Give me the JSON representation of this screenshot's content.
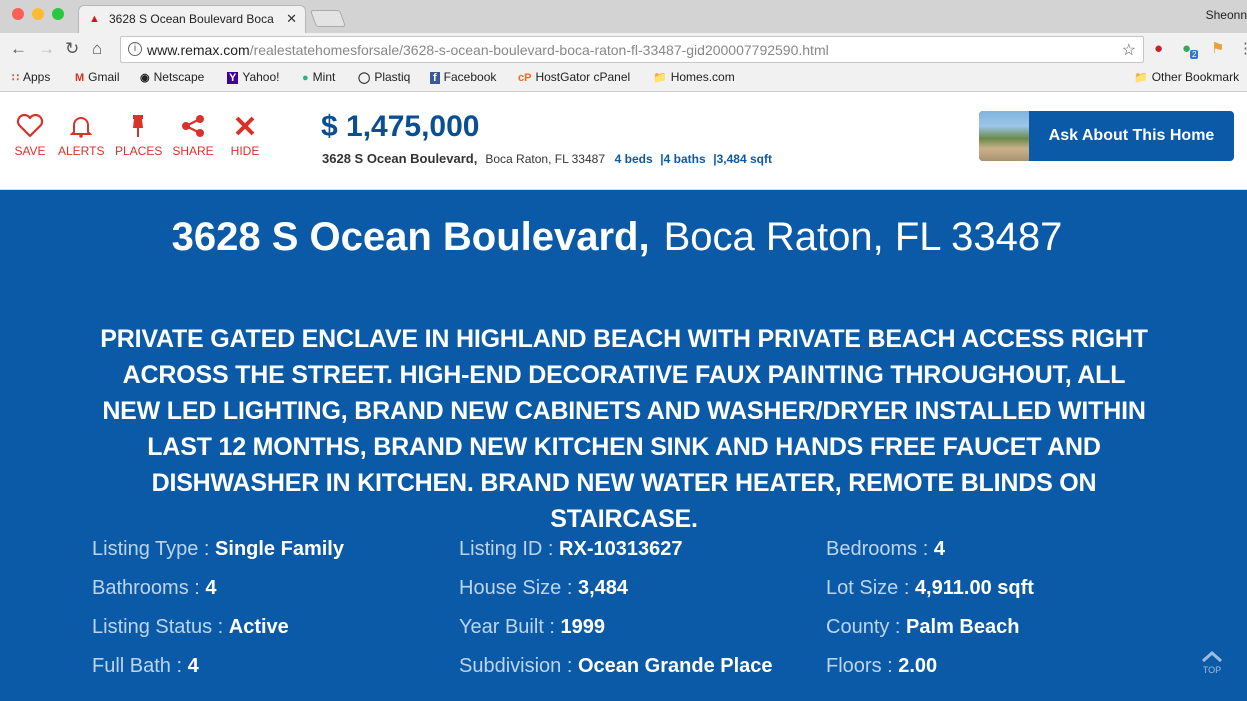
{
  "browser": {
    "tab_title": "3628 S Ocean Boulevard Boca",
    "user": "Sheonn",
    "url_host": "www.remax.com",
    "url_path": "/realestatehomesforsale/3628-s-ocean-boulevard-boca-raton-fl-33487-gid200007792590.html",
    "extension_badge": "2",
    "bookmarks": [
      "Apps",
      "Gmail",
      "Netscape",
      "Yahoo!",
      "Mint",
      "Plastiq",
      "Facebook",
      "HostGator cPanel",
      "Homes.com"
    ],
    "other_bookmarks": "Other Bookmark"
  },
  "header": {
    "actions": [
      "SAVE",
      "ALERTS",
      "PLACES",
      "SHARE",
      "HIDE"
    ],
    "price": "$ 1,475,000",
    "street": "3628 S Ocean Boulevard,",
    "city": "Boca Raton, FL 33487",
    "beds": "4 beds",
    "baths": "|4 baths",
    "sqft": "|3,484 sqft",
    "ask_button": "Ask About This Home"
  },
  "listing": {
    "title_street": "3628 S Ocean Boulevard,",
    "title_city": "Boca Raton, FL 33487",
    "description": "PRIVATE GATED ENCLAVE IN HIGHLAND BEACH WITH PRIVATE BEACH ACCESS RIGHT ACROSS THE STREET. HIGH-END DECORATIVE FAUX PAINTING THROUGHOUT, ALL NEW LED LIGHTING, BRAND NEW CABINETS AND WASHER/DRYER INSTALLED WITHIN LAST 12 MONTHS, BRAND NEW KITCHEN SINK AND HANDS FREE FAUCET AND DISHWASHER IN KITCHEN. BRAND NEW WATER HEATER, REMOTE BLINDS ON STAIRCASE.",
    "facts": [
      {
        "label": "Listing Type : ",
        "value": "Single Family"
      },
      {
        "label": "Listing ID : ",
        "value": "RX-10313627"
      },
      {
        "label": "Bedrooms : ",
        "value": "4"
      },
      {
        "label": "Bathrooms : ",
        "value": "4"
      },
      {
        "label": "House Size : ",
        "value": "3,484"
      },
      {
        "label": "Lot Size : ",
        "value": "4,911.00 sqft"
      },
      {
        "label": "Listing Status : ",
        "value": "Active"
      },
      {
        "label": "Year Built : ",
        "value": "1999"
      },
      {
        "label": "County : ",
        "value": "Palm Beach"
      },
      {
        "label": "Full Bath : ",
        "value": "4"
      },
      {
        "label": "Subdivision : ",
        "value": "Ocean Grande Place"
      },
      {
        "label": "Floors : ",
        "value": "2.00"
      }
    ],
    "to_top": "TOP"
  }
}
